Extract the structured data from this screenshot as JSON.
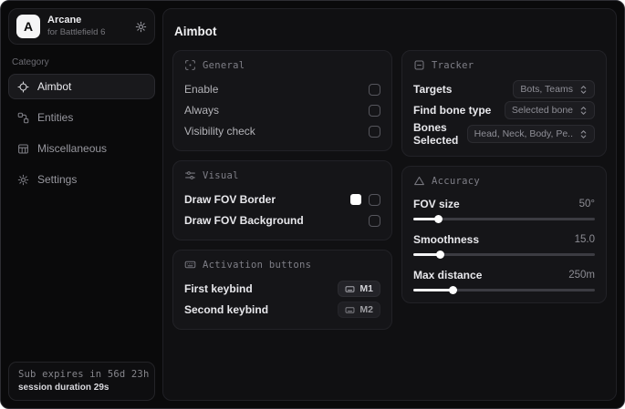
{
  "app": {
    "logo_letter": "A",
    "name": "Arcane",
    "subtitle": "for Battlefield 6"
  },
  "sidebar": {
    "category_label": "Category",
    "items": [
      {
        "label": "Aimbot",
        "icon": "crosshair-icon",
        "active": true
      },
      {
        "label": "Entities",
        "icon": "entities-icon",
        "active": false
      },
      {
        "label": "Miscellaneous",
        "icon": "grid-icon",
        "active": false
      },
      {
        "label": "Settings",
        "icon": "gear-icon",
        "active": false
      }
    ],
    "subscription": {
      "expires_text": "Sub expires in 56d 23h",
      "session_text": "session duration 29s"
    }
  },
  "main": {
    "title": "Aimbot",
    "general": {
      "title": "General",
      "icon": "scan-icon",
      "rows": [
        {
          "label": "Enable",
          "checked": false
        },
        {
          "label": "Always",
          "checked": false
        },
        {
          "label": "Visibility check",
          "checked": false
        }
      ]
    },
    "visual": {
      "title": "Visual",
      "icon": "sliders-icon",
      "rows": [
        {
          "label": "Draw FOV Border",
          "swatch_color": "#ffffff",
          "checked": false
        },
        {
          "label": "Draw FOV Background",
          "checked": false
        }
      ]
    },
    "activation": {
      "title": "Activation buttons",
      "icon": "keyboard-icon",
      "rows": [
        {
          "label": "First keybind",
          "key": "M1"
        },
        {
          "label": "Second keybind",
          "key": "M2"
        }
      ]
    },
    "tracker": {
      "title": "Tracker",
      "icon": "frame-minus-icon",
      "rows": [
        {
          "label": "Targets",
          "value": "Bots, Teams"
        },
        {
          "label": "Find bone type",
          "value": "Selected bone"
        },
        {
          "label": "Bones Selected",
          "value": "Head, Neck, Body, Pe.."
        }
      ]
    },
    "accuracy": {
      "title": "Accuracy",
      "icon": "triangle-icon",
      "rows": [
        {
          "label": "FOV size",
          "value": "50°",
          "percent": 14
        },
        {
          "label": "Smoothness",
          "value": "15.0",
          "percent": 15
        },
        {
          "label": "Max distance",
          "value": "250m",
          "percent": 22
        }
      ]
    }
  }
}
